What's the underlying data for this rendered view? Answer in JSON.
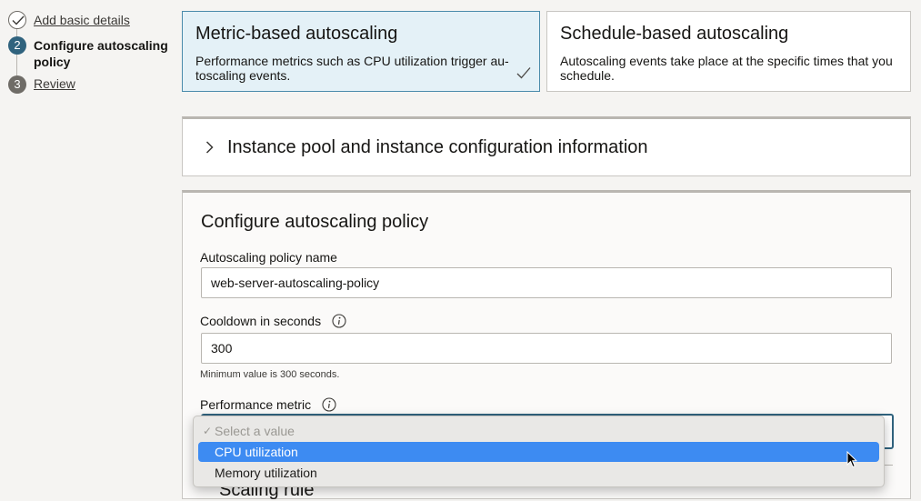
{
  "steps": [
    {
      "number": "",
      "label": "Add basic details",
      "state": "complete"
    },
    {
      "number": "2",
      "label": "Configure autoscaling policy",
      "state": "current"
    },
    {
      "number": "3",
      "label": "Review",
      "state": "pending"
    }
  ],
  "autoscaling_types": [
    {
      "title": "Metric-based autoscaling",
      "description": "Performance metrics such as CPU utilization trigger au-toscaling events.",
      "selected": true
    },
    {
      "title": "Schedule-based autoscaling",
      "description": "Autoscaling events take place at the specific times that you schedule.",
      "selected": false
    }
  ],
  "instance_pool_section": {
    "title": "Instance pool and instance configuration information",
    "expanded": false
  },
  "policy_section": {
    "title": "Configure autoscaling policy",
    "policy_name": {
      "label": "Autoscaling policy name",
      "value": "web-server-autoscaling-policy"
    },
    "cooldown": {
      "label": "Cooldown in seconds",
      "value": "300",
      "help": "Minimum value is 300 seconds."
    },
    "performance_metric": {
      "label": "Performance metric",
      "options": [
        {
          "label": "Select a value",
          "state": "placeholder",
          "checked": true
        },
        {
          "label": "CPU utilization",
          "state": "highlighted",
          "checked": false
        },
        {
          "label": "Memory utilization",
          "state": "normal",
          "checked": false
        }
      ]
    },
    "next_heading_partial": "Scaling rule"
  },
  "colors": {
    "accent": "#30637e",
    "selected_card_bg": "#e4f1f7",
    "menu_highlight": "#3d8bf2"
  }
}
